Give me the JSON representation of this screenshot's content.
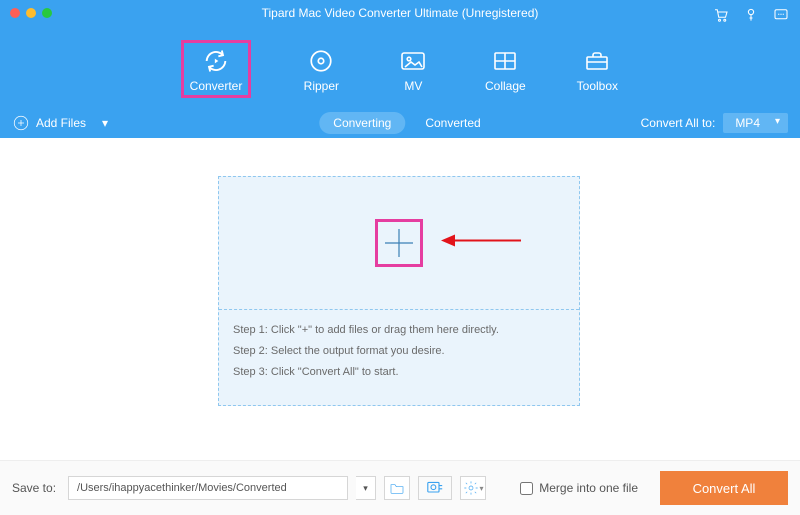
{
  "window": {
    "title": "Tipard Mac Video Converter Ultimate (Unregistered)"
  },
  "header_icons": {
    "cart": "cart-icon",
    "key": "key-icon",
    "menu": "menu-icon"
  },
  "tabs": {
    "converter": "Converter",
    "ripper": "Ripper",
    "mv": "MV",
    "collage": "Collage",
    "toolbox": "Toolbox"
  },
  "subbar": {
    "add_files": "Add Files",
    "segmented": {
      "converting": "Converting",
      "converted": "Converted"
    },
    "convert_all_to_label": "Convert All to:",
    "format": "MP4"
  },
  "dropzone": {
    "step1": "Step 1: Click \"+\" to add files or drag them here directly.",
    "step2": "Step 2: Select the output format you desire.",
    "step3": "Step 3: Click \"Convert All\" to start."
  },
  "footer": {
    "save_to_label": "Save to:",
    "path": "/Users/ihappyacethinker/Movies/Converted",
    "merge_label": "Merge into one file",
    "convert_all_button": "Convert All"
  }
}
